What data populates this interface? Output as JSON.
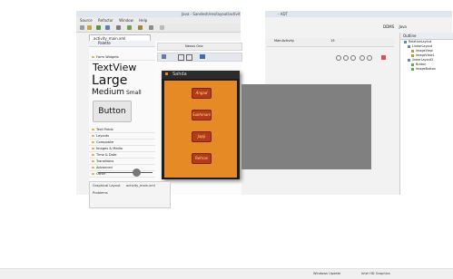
{
  "window": {
    "title_left": "Java - Sandesh/res/layout/activity_",
    "title_right": "- ADT",
    "perspective": "DDMS",
    "perspective2": "Java"
  },
  "menus": [
    "Source",
    "Refactor",
    "Window",
    "Help"
  ],
  "editor": {
    "tab_label": "activity_main.xml"
  },
  "palette": {
    "header": "Palette",
    "categories_top": [
      "Form Widgets"
    ],
    "widgets": {
      "textview": "TextView",
      "large": "Large",
      "medium": "Medium",
      "small": "Small",
      "button": "Button"
    },
    "categories": [
      "Text Fields",
      "Layouts",
      "Composite",
      "Images & Media",
      "Time & Date",
      "Transitions",
      "Advanced",
      "Other"
    ]
  },
  "canvas": {
    "device_label": "Nexus One",
    "theme_label": "MainActivity",
    "api_label": "19",
    "app_title": "Sahda",
    "items": [
      "Angad",
      "Sukhmani",
      "Japji",
      "Rehras"
    ]
  },
  "outline": {
    "header": "Outline",
    "items": [
      "RelativeLayout",
      "LinearLayout",
      "ImageView",
      "imageView1",
      "linearLayout2",
      "Button",
      "ImageButton"
    ]
  },
  "bottom_panel": {
    "tabs": [
      "Graphical Layout",
      "activity_main.xml"
    ],
    "row2": "Problems"
  },
  "taskbar": {
    "items": [
      "Windows Update",
      "Intel HD Graphics"
    ]
  }
}
